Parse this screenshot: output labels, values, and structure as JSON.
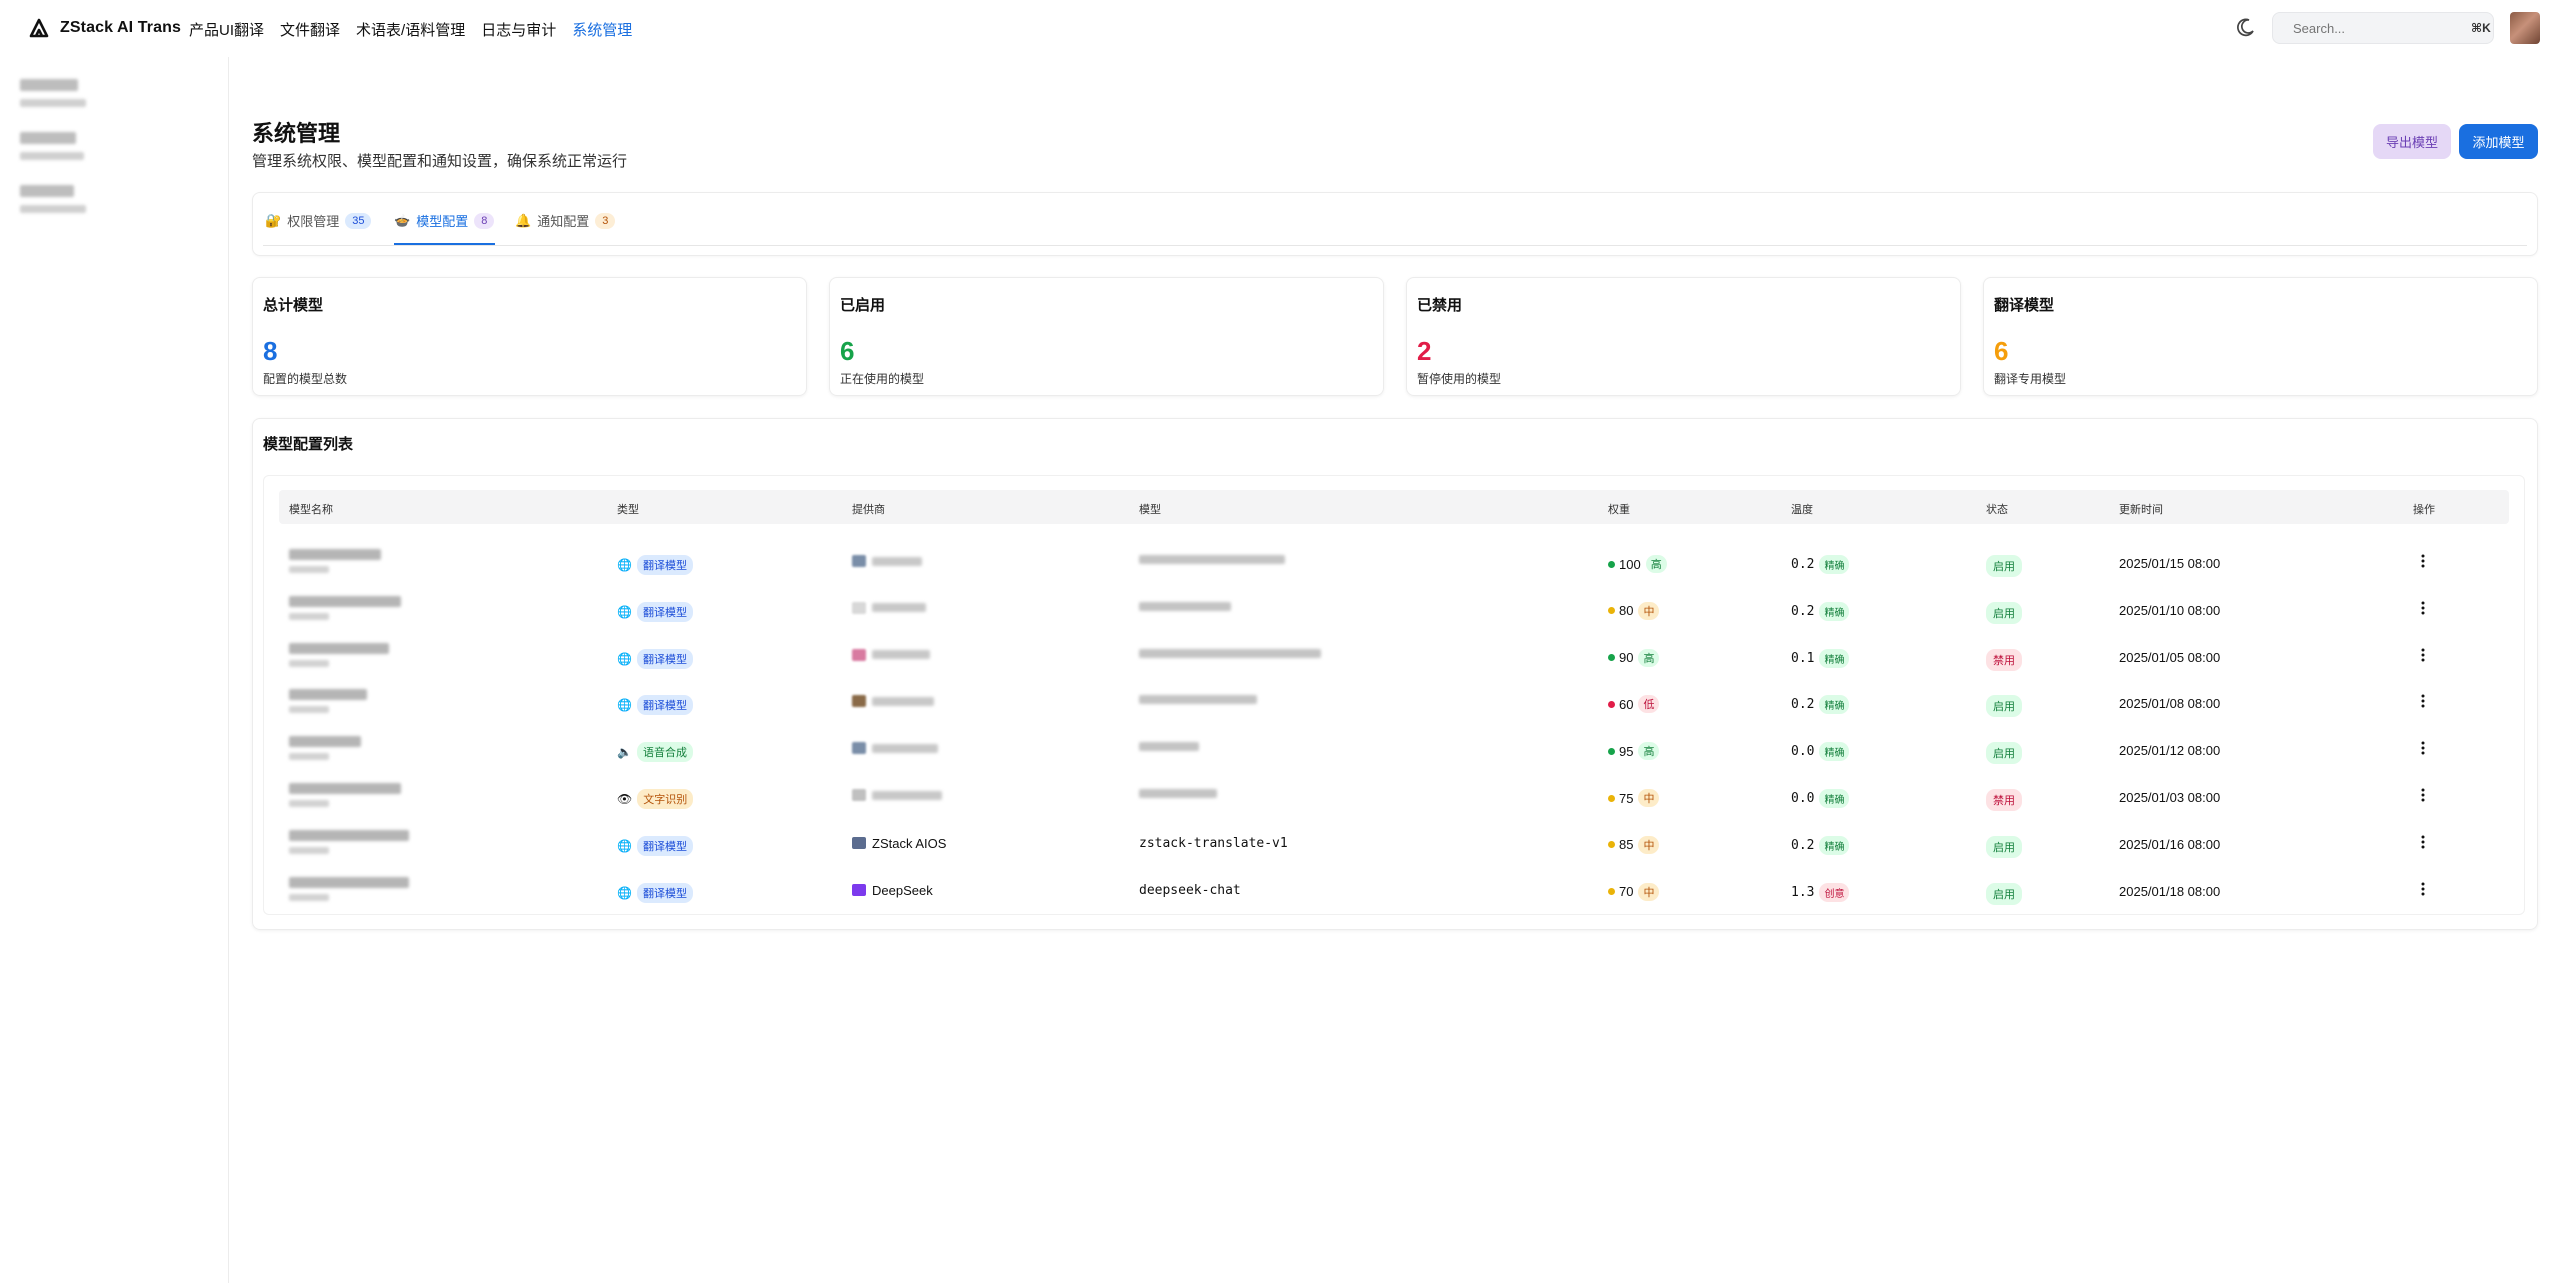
{
  "app": {
    "name": "ZStack AI Trans"
  },
  "nav": {
    "items": [
      "产品UI翻译",
      "文件翻译",
      "术语表/语料管理",
      "日志与审计",
      "系统管理"
    ],
    "active_index": 4
  },
  "search": {
    "placeholder": "Search...",
    "shortcut": "⌘K"
  },
  "page": {
    "title": "系统管理",
    "subtitle": "管理系统权限、模型配置和通知设置，确保系统正常运行"
  },
  "actions": {
    "export": "导出模型",
    "add": "添加模型"
  },
  "tabs": [
    {
      "icon": "🔐",
      "label": "权限管理",
      "count": "35",
      "badge_bg": "#dbeafe",
      "badge_fg": "#1d4ed8"
    },
    {
      "icon": "🍲",
      "label": "模型配置",
      "count": "8",
      "badge_bg": "#ede4fb",
      "badge_fg": "#6b3fb4"
    },
    {
      "icon": "🔔",
      "label": "通知配置",
      "count": "3",
      "badge_bg": "#fdeed6",
      "badge_fg": "#b45309"
    }
  ],
  "stats": [
    {
      "title": "总计模型",
      "value": "8",
      "desc": "配置的模型总数",
      "color": "#1a6fe0"
    },
    {
      "title": "已启用",
      "value": "6",
      "desc": "正在使用的模型",
      "color": "#16a34a"
    },
    {
      "title": "已禁用",
      "value": "2",
      "desc": "暂停使用的模型",
      "color": "#e11d48"
    },
    {
      "title": "翻译模型",
      "value": "6",
      "desc": "翻译专用模型",
      "color": "#f59e0b"
    }
  ],
  "list": {
    "title": "模型配置列表",
    "columns": [
      "模型名称",
      "类型",
      "提供商",
      "模型",
      "权重",
      "温度",
      "状态",
      "更新时间",
      "操作"
    ],
    "rows": [
      {
        "type_icon": "🌐",
        "type": "翻译模型",
        "type_color": "blue",
        "provider": "",
        "provider_icon_color": "#7a8ea8",
        "model": "",
        "weight": "100",
        "weight_level": "高",
        "weight_color": "#16a34a",
        "temp": "0.2",
        "temp_label": "精确",
        "status": "启用",
        "updated": "2025/01/15 08:00"
      },
      {
        "type_icon": "🌐",
        "type": "翻译模型",
        "type_color": "blue",
        "provider": "",
        "provider_icon_color": "#d8d8d8",
        "model": "",
        "weight": "80",
        "weight_level": "中",
        "weight_color": "#eab308",
        "temp": "0.2",
        "temp_label": "精确",
        "status": "启用",
        "updated": "2025/01/10 08:00"
      },
      {
        "type_icon": "🌐",
        "type": "翻译模型",
        "type_color": "blue",
        "provider": "",
        "provider_icon_color": "#d87aa0",
        "model": "",
        "weight": "90",
        "weight_level": "高",
        "weight_color": "#16a34a",
        "temp": "0.1",
        "temp_label": "精确",
        "status": "禁用",
        "updated": "2025/01/05 08:00"
      },
      {
        "type_icon": "🌐",
        "type": "翻译模型",
        "type_color": "blue",
        "provider": "",
        "provider_icon_color": "#8a6a48",
        "model": "",
        "weight": "60",
        "weight_level": "低",
        "weight_color": "#e11d48",
        "temp": "0.2",
        "temp_label": "精确",
        "status": "启用",
        "updated": "2025/01/08 08:00"
      },
      {
        "type_icon": "🔈",
        "type": "语音合成",
        "type_color": "green",
        "provider": "",
        "provider_icon_color": "#7a8ea8",
        "model": "",
        "weight": "95",
        "weight_level": "高",
        "weight_color": "#16a34a",
        "temp": "0.0",
        "temp_label": "精确",
        "status": "启用",
        "updated": "2025/01/12 08:00"
      },
      {
        "type_icon": "👁",
        "type": "文字识别",
        "type_color": "amber",
        "provider": "",
        "provider_icon_color": "#c0c0c0",
        "model": "",
        "weight": "75",
        "weight_level": "中",
        "weight_color": "#eab308",
        "temp": "0.0",
        "temp_label": "精确",
        "status": "禁用",
        "updated": "2025/01/03 08:00"
      },
      {
        "type_icon": "🌐",
        "type": "翻译模型",
        "type_color": "blue",
        "provider": "ZStack AIOS",
        "provider_icon_color": "#5b6c8f",
        "model": "zstack-translate-v1",
        "weight": "85",
        "weight_level": "中",
        "weight_color": "#eab308",
        "temp": "0.2",
        "temp_label": "精确",
        "status": "启用",
        "updated": "2025/01/16 08:00"
      },
      {
        "type_icon": "🌐",
        "type": "翻译模型",
        "type_color": "blue",
        "provider": "DeepSeek",
        "provider_icon_color": "#7c3aed",
        "model": "deepseek-chat",
        "weight": "70",
        "weight_level": "中",
        "weight_color": "#eab308",
        "temp": "1.3",
        "temp_label": "创意",
        "status": "启用",
        "updated": "2025/01/18 08:00"
      }
    ]
  }
}
